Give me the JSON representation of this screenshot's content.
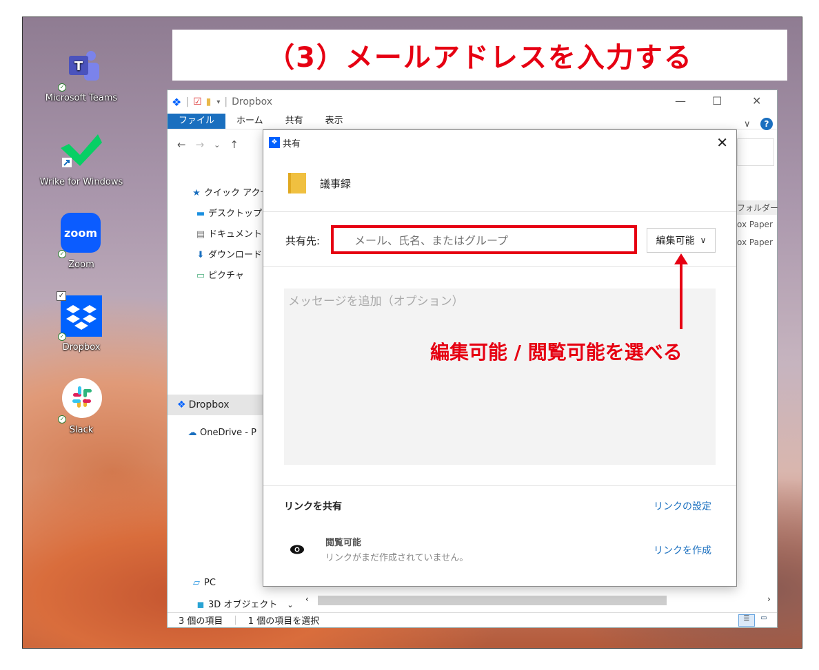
{
  "banner": {
    "title": "（3）メールアドレスを入力する"
  },
  "desktop": {
    "icons": [
      {
        "label": "Microsoft Teams"
      },
      {
        "label": "Wrike for Windows"
      },
      {
        "label": "Zoom",
        "logo_text": "zoom"
      },
      {
        "label": "Dropbox"
      },
      {
        "label": "Slack"
      }
    ]
  },
  "explorer": {
    "window_title": "Dropbox",
    "ribbon_tabs": [
      "ファイル",
      "ホーム",
      "共有",
      "表示"
    ],
    "nav_items": [
      "クイック アクセス",
      "デスクトップ",
      "ドキュメント",
      "ダウンロード",
      "ピクチャ",
      "Dropbox",
      "OneDrive - P",
      "PC",
      "3D オブジェクト"
    ],
    "right_col": [
      "フォルダー",
      "ox Paper",
      "ox Paper"
    ],
    "status": {
      "items": "3 個の項目",
      "selected": "1 個の項目を選択"
    }
  },
  "dialog": {
    "title": "共有",
    "folder_name": "議事録",
    "share_label": "共有先:",
    "share_placeholder": "メール、氏名、またはグループ",
    "permission": "編集可能",
    "message_placeholder": "メッセージを追加（オプション）",
    "link_section": {
      "heading": "リンクを共有",
      "settings_link": "リンクの設定",
      "access_title": "閲覧可能",
      "access_status": "リンクがまだ作成されていません。",
      "create_link": "リンクを作成"
    }
  },
  "annotation": {
    "text": "編集可能 / 閲覧可能を選べる"
  },
  "colors": {
    "accent_red": "#e60012",
    "link_blue": "#1a6fbf",
    "ribbon_blue": "#1a6fbf",
    "dropbox_blue": "#0061fe"
  }
}
